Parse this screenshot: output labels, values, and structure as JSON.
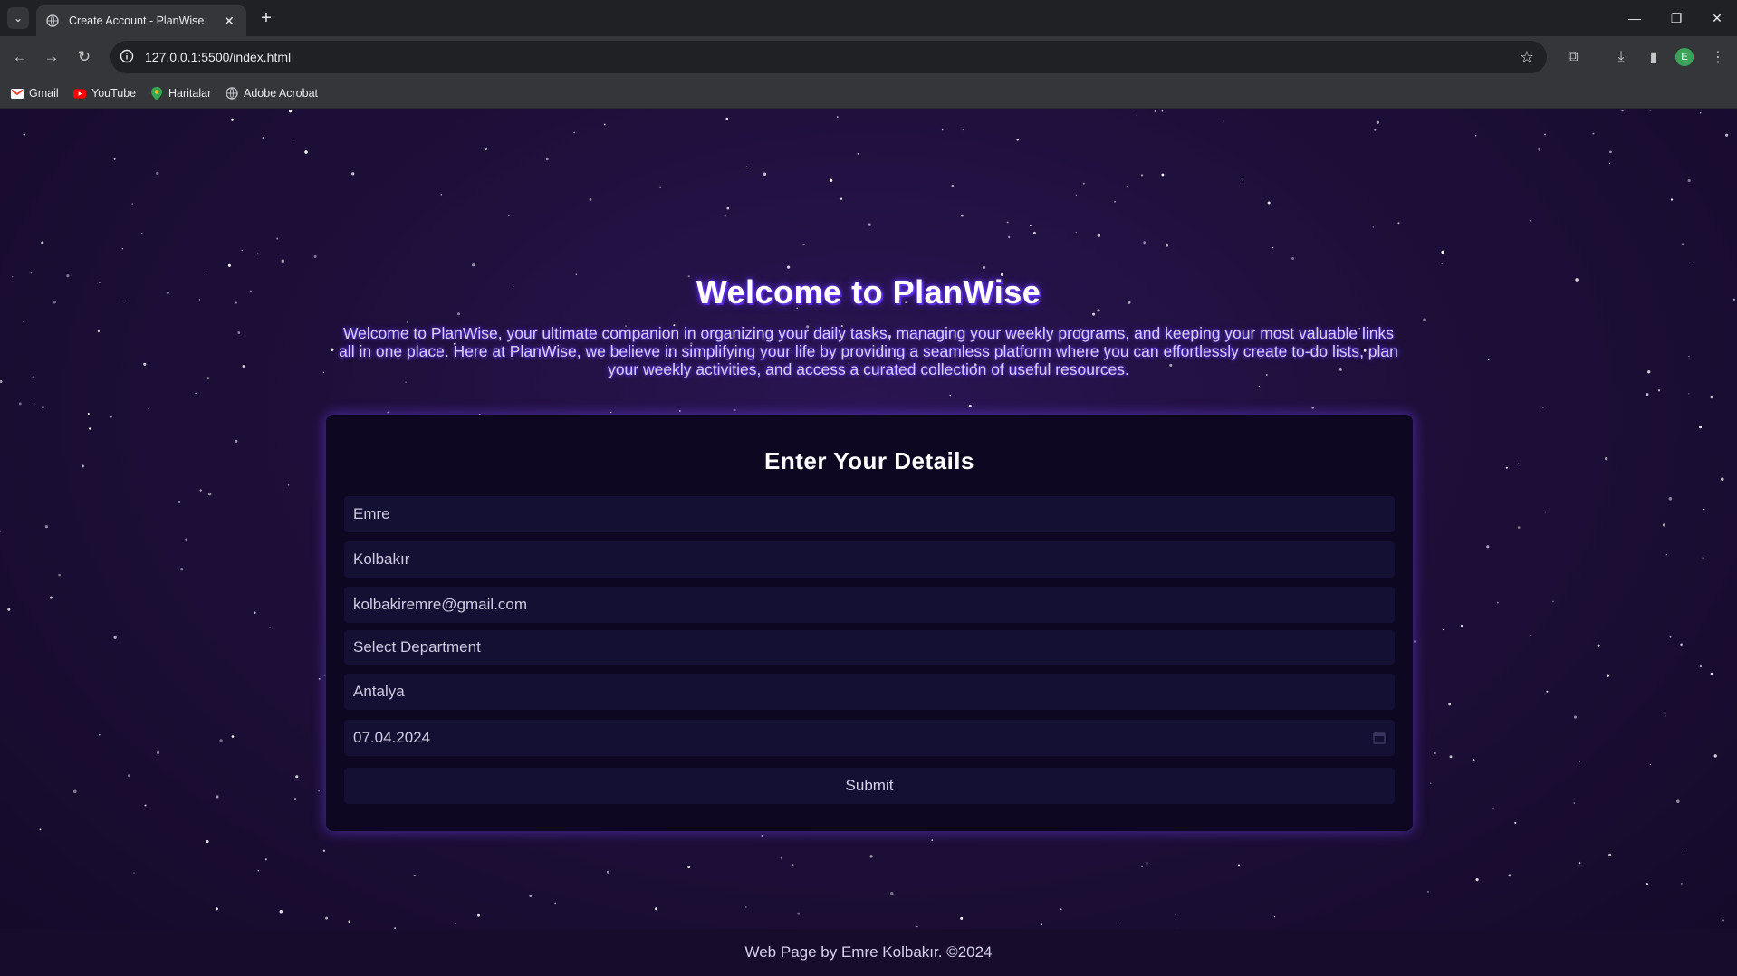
{
  "browser": {
    "tab_title": "Create Account - PlanWise",
    "url": "127.0.0.1:5500/index.html",
    "profile_initial": "E",
    "bookmarks": [
      {
        "label": "Gmail",
        "icon": "gmail-icon"
      },
      {
        "label": "YouTube",
        "icon": "youtube-icon"
      },
      {
        "label": "Haritalar",
        "icon": "maps-icon"
      },
      {
        "label": "Adobe Acrobat",
        "icon": "globe-icon"
      }
    ]
  },
  "hero": {
    "title": "Welcome to PlanWise",
    "text": "Welcome to PlanWise, your ultimate companion in organizing your daily tasks, managing your weekly programs, and keeping your most valuable links all in one place. Here at PlanWise, we believe in simplifying your life by providing a seamless platform where you can effortlessly create to-do lists, plan your weekly activities, and access a curated collection of useful resources."
  },
  "form": {
    "title": "Enter Your Details",
    "first_name": "Emre",
    "last_name": "Kolbakır",
    "email": "kolbakiremre@gmail.com",
    "department": "Select Department",
    "city": "Antalya",
    "date": "07.04.2024",
    "submit_label": "Submit"
  },
  "footer": {
    "text": "Web Page by Emre Kolbakır. ©2024"
  },
  "colors": {
    "page_bg": "#1e0f3a",
    "card_bg": "#0d0722",
    "field_bg": "#141033",
    "glow": "#6a3cff"
  }
}
